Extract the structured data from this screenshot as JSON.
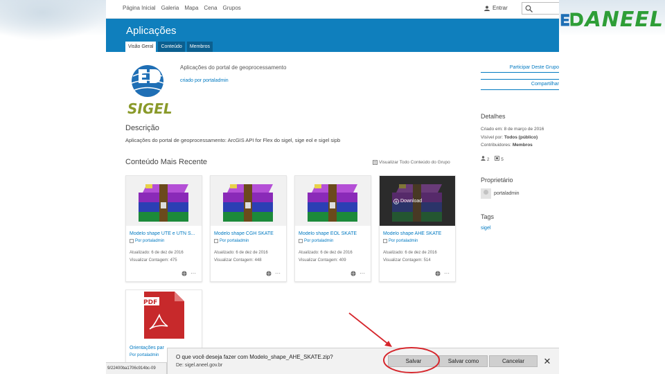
{
  "slide": {
    "logo_text": "ANEEL",
    "colors": {
      "logo_green": "#2e9e37",
      "logo_blue": "#1f6fb5",
      "annotation_red": "#d6262c"
    }
  },
  "topnav": {
    "links": [
      "Página Inicial",
      "Galeria",
      "Mapa",
      "Cena",
      "Grupos"
    ],
    "signin_label": "Entrar",
    "search_icon": "magnifier-icon"
  },
  "banner": {
    "title": "Aplicações",
    "tabs": [
      "Visão Geral",
      "Conteúdo",
      "Membros"
    ],
    "active_tab": 0,
    "color": "#0f7fbd"
  },
  "group": {
    "logo_text": "SIGEL",
    "summary": "Aplicações do portal de geoprocessamento",
    "owner_line": "criado por portaladmin"
  },
  "description": {
    "heading": "Descrição",
    "text": "Aplicações do portal de geoprocessamento: ArcGIS API for Flex do sigel, sige eol e sigel sipb"
  },
  "recent": {
    "heading": "Conteúdo Mais Recente",
    "view_all": "Visualizar Todo Conteúdo do Grupo",
    "cards": [
      {
        "title": "Modelo shape UTE e UTN S...",
        "owner": "Por portaladmin",
        "updated": "Atualizado: 6 de dez de 2016",
        "views": "Visualizar Contagem: 475",
        "thumb": "winrar-archive-icon"
      },
      {
        "title": "Modelo shape CGH SKATE",
        "owner": "Por portaladmin",
        "updated": "Atualizado: 6 de dez de 2016",
        "views": "Visualizar Contagem: 448",
        "thumb": "winrar-archive-icon"
      },
      {
        "title": "Modelo shape EOL SKATE",
        "owner": "Por portaladmin",
        "updated": "Atualizado: 6 de dez de 2016",
        "views": "Visualizar Contagem: 409",
        "thumb": "winrar-archive-icon"
      },
      {
        "title": "Modelo shape AHE SKATE",
        "owner": "Por portaladmin",
        "updated": "Atualizado: 6 de dez de 2016",
        "views": "Visualizar Contagem: 514",
        "thumb": "winrar-archive-icon",
        "overlay": "Download"
      }
    ],
    "pdf_card": {
      "title": "Orientações par",
      "owner": "Por portaladmin",
      "badge": "PDF"
    }
  },
  "sidebar": {
    "join": "Participar Deste Grupo",
    "share": "Compartilhar",
    "details_heading": "Detalhes",
    "created": "Criado em: 8 de março de 2016",
    "visible_label": "Visível por:",
    "visible_value": "Todos (público)",
    "contributors_label": "Contribuidores:",
    "contributors_value": "Membros",
    "members_count": "2",
    "items_count": "5",
    "owner_heading": "Proprietário",
    "owner_name": "portaladmin",
    "tags_heading": "Tags",
    "tag": "sigel"
  },
  "statusbar": {
    "url": "9/22400ba1706c914bc-09"
  },
  "download_bar": {
    "question": "O que você deseja fazer com Modelo_shape_AHE_SKATE.zip?",
    "source": "De: sigel.aneel.gov.br",
    "save": "Salvar",
    "save_as": "Salvar como",
    "cancel": "Cancelar"
  }
}
